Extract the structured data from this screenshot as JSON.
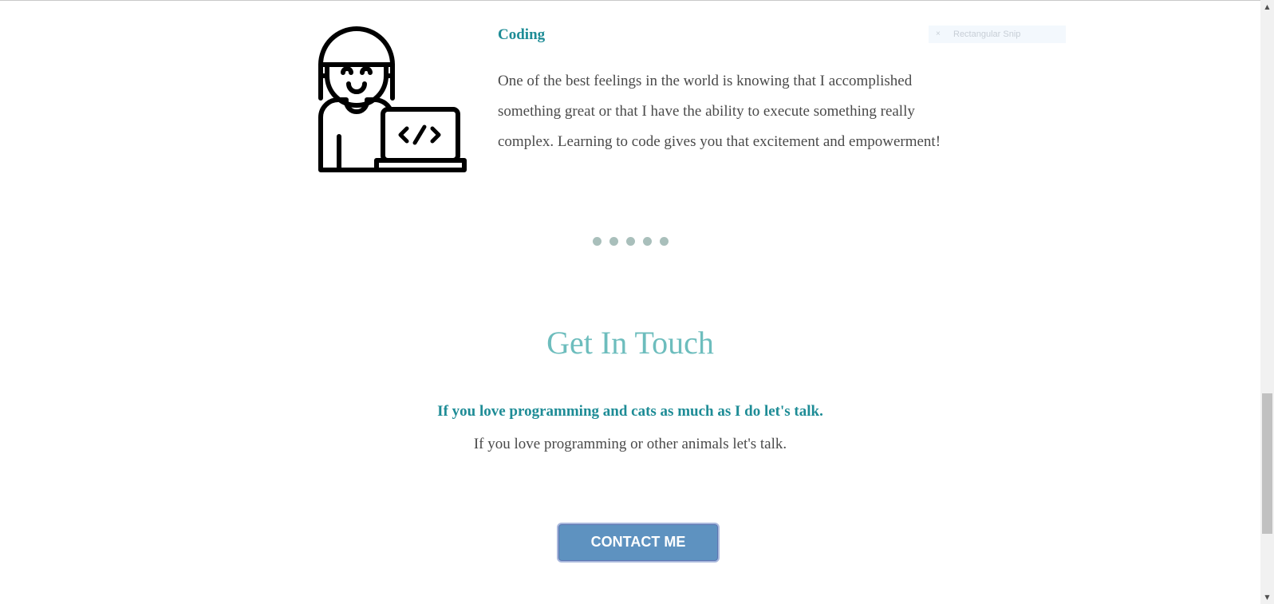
{
  "card": {
    "title": "Coding",
    "text": "One of the best feelings in the world is knowing that I accomplished something great or that I have the ability to execute something really complex. Learning to code gives you that excitement and empowerment!",
    "illustration_icon": "coder-with-laptop-icon"
  },
  "snip_overlay": {
    "label": "Rectangular Snip",
    "icon": "×"
  },
  "carousel": {
    "dot_count": 5
  },
  "contact": {
    "title": "Get In Touch",
    "subtitle": "If you love programming and cats as much as I do let's talk.",
    "text": "If you love programming or other animals let's talk.",
    "button_label": "CONTACT ME"
  },
  "scrollbar": {
    "up_arrow": "▲",
    "down_arrow": "▼"
  },
  "colors": {
    "accent_teal": "#1e8c96",
    "heading_teal": "#6dbdbd",
    "button_blue": "#5e92c0",
    "dot_gray": "#a9bfbb",
    "body_text": "#4a4a4a"
  }
}
